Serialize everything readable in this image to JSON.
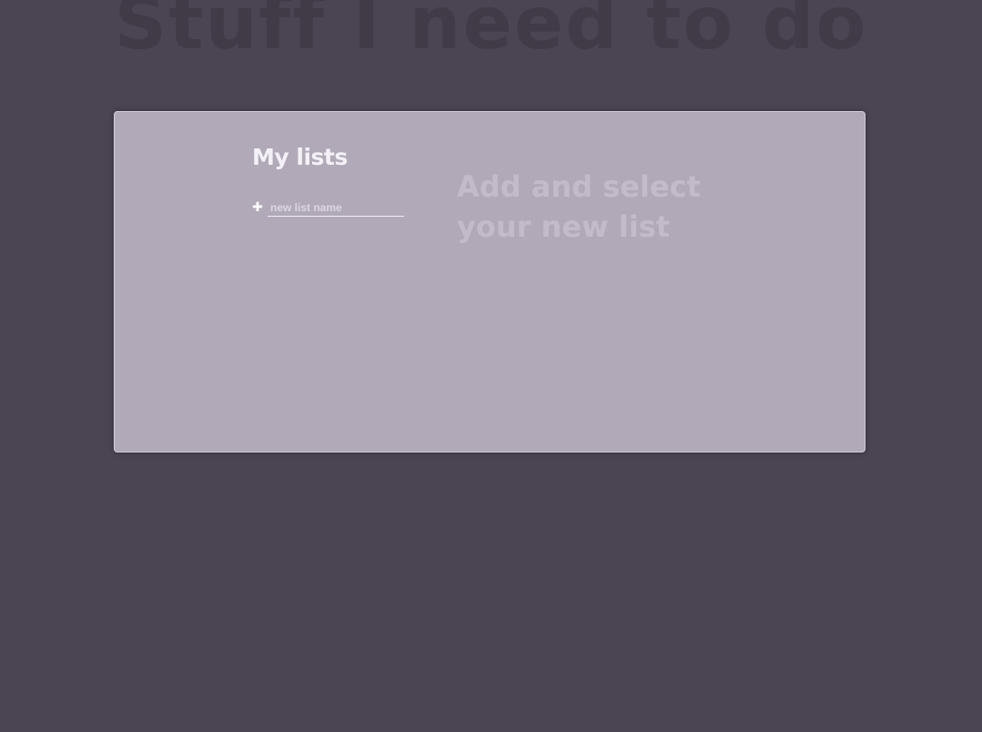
{
  "header": {
    "title": "Stuff I need to do"
  },
  "lists_panel": {
    "heading": "My lists",
    "new_list": {
      "add_icon": "plus-icon",
      "add_glyph": "✚",
      "placeholder": "new list name",
      "value": ""
    }
  },
  "tasks_panel": {
    "empty_message": "Add and select your new list"
  },
  "colors": {
    "background": "#4b4452",
    "panel": "#b1a9b8",
    "title_text": "#413a47",
    "heading_text": "#f4f1f6",
    "empty_message_text": "#c3bbc9"
  }
}
